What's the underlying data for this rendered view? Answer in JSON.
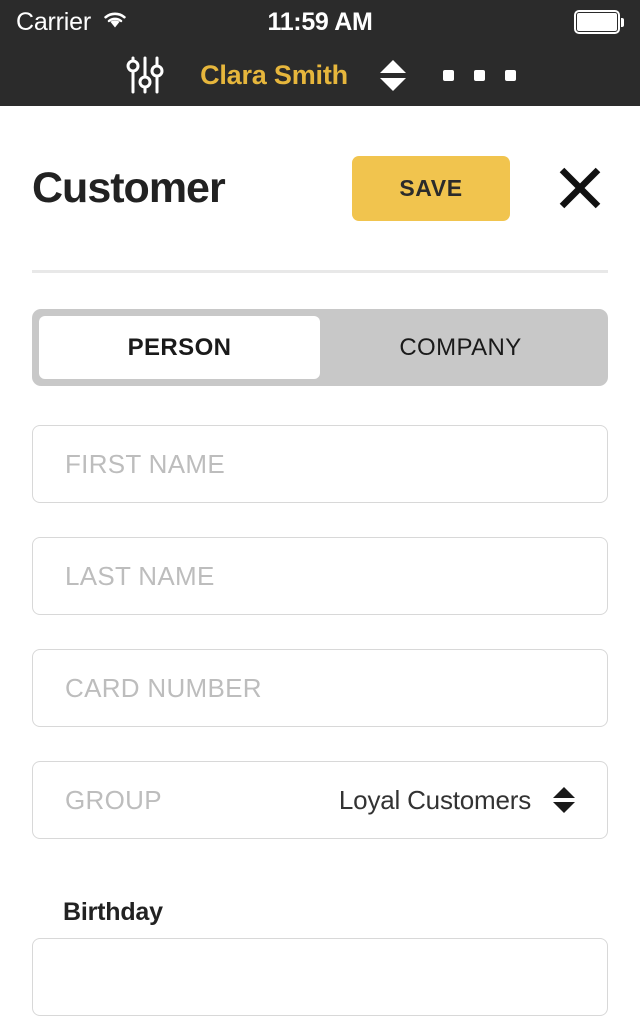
{
  "status_bar": {
    "carrier": "Carrier",
    "wifi_icon": "wifi-icon",
    "time": "11:59 AM",
    "battery_icon": "battery-full-icon"
  },
  "nav_bar": {
    "sliders_icon": "sliders-icon",
    "title": "Clara Smith",
    "stepper_icon": "up-down-stepper-icon",
    "more_icon": "more-dots-icon",
    "title_color": "#E6B63C",
    "background_color": "#2B2B2B"
  },
  "header": {
    "title": "Customer",
    "save_label": "SAVE",
    "save_color": "#F1C44E",
    "close_icon": "close-x-icon"
  },
  "segmented_control": {
    "selected": "PERSON",
    "options": [
      {
        "label": "PERSON",
        "selected": true
      },
      {
        "label": "COMPANY",
        "selected": false
      }
    ],
    "track_color": "#C8C8C8"
  },
  "form": {
    "fields": [
      {
        "name": "first-name",
        "placeholder": "FIRST NAME",
        "value": ""
      },
      {
        "name": "last-name",
        "placeholder": "LAST NAME",
        "value": ""
      },
      {
        "name": "card-number",
        "placeholder": "CARD NUMBER",
        "value": ""
      }
    ],
    "group": {
      "placeholder": "GROUP",
      "value": "Loyal Customers",
      "stepper_icon": "up-down-stepper-icon"
    },
    "birthday_heading": "Birthday"
  }
}
